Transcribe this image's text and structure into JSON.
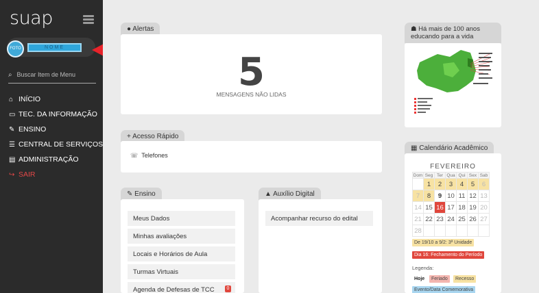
{
  "sidebar": {
    "logo": "suap",
    "avatar_text": "FOTO",
    "user_name": "NOME",
    "search_placeholder": "Buscar Item de Menu",
    "items": [
      {
        "icon": "home-icon",
        "glyph": "⌂",
        "label": "INÍCIO"
      },
      {
        "icon": "monitor-icon",
        "glyph": "▭",
        "label": "TEC. DA INFORMAÇÃO"
      },
      {
        "icon": "pencil-icon",
        "glyph": "✎",
        "label": "ENSINO"
      },
      {
        "icon": "list-icon",
        "glyph": "☰",
        "label": "CENTRAL DE SERVIÇOS"
      },
      {
        "icon": "grid-icon",
        "glyph": "▤",
        "label": "ADMINISTRAÇÃO"
      },
      {
        "icon": "logout-icon",
        "glyph": "↪",
        "label": "SAIR"
      }
    ]
  },
  "alerts": {
    "tab": "Alertas",
    "count": "5",
    "label": "MENSAGENS NÃO LIDAS"
  },
  "quick_access": {
    "tab": "Acesso Rápido",
    "items": [
      "Telefones"
    ]
  },
  "ensino": {
    "tab": "Ensino",
    "items": [
      "Meus Dados",
      "Minhas avaliações",
      "Locais e Horários de Aula",
      "Turmas Virtuais",
      "Agenda de Defesas de TCC"
    ],
    "badge": "0"
  },
  "auxilio": {
    "tab": "Auxílio Digital",
    "items": [
      "Acompanhar recurso do edital"
    ]
  },
  "bahia": {
    "tab": "Há mais de 100 anos educando para a vida"
  },
  "calendar": {
    "tab": "Calendário Acadêmico",
    "month": "FEVEREIRO",
    "weekdays": [
      "Dom",
      "Seg",
      "Ter",
      "Qua",
      "Qui",
      "Sex",
      "Sab"
    ],
    "weeks": [
      [
        "",
        "1",
        "2",
        "3",
        "4",
        "5",
        "6"
      ],
      [
        "7",
        "8",
        "9",
        "10",
        "11",
        "12",
        "13"
      ],
      [
        "14",
        "15",
        "16",
        "17",
        "18",
        "19",
        "20"
      ],
      [
        "21",
        "22",
        "23",
        "24",
        "25",
        "26",
        "27"
      ],
      [
        "28",
        "",
        "",
        "",
        "",
        "",
        ""
      ]
    ],
    "event_yellow": "De 19/10 a 9/2: 3ª Unidade",
    "event_red": "Dia 16: Fechamento do Período",
    "legend_title": "Legenda:",
    "legend": [
      "Hoje",
      "Feriado",
      "Recesso",
      "Evento/Data Comemorativa"
    ],
    "colors": {
      "accent": "#e0463c",
      "yellow": "#f7e2a3",
      "blue": "#a9d6f0",
      "pink": "#f4b6b0"
    }
  }
}
